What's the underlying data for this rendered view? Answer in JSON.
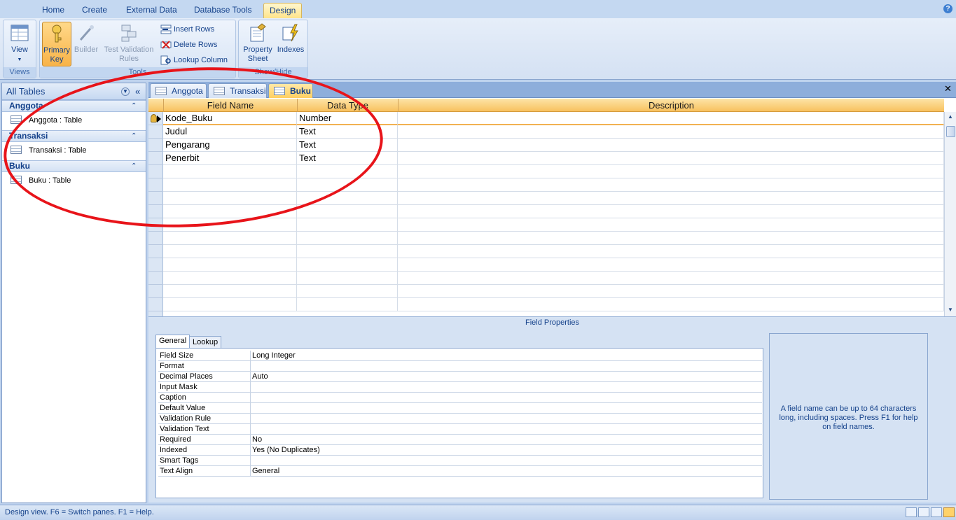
{
  "ribbon": {
    "tabs": [
      "Home",
      "Create",
      "External Data",
      "Database Tools",
      "Design"
    ],
    "active_tab": "Design",
    "groups": {
      "views": {
        "label": "Views",
        "view_button": "View"
      },
      "tools": {
        "label": "Tools",
        "primary_key": "Primary Key",
        "builder": "Builder",
        "test_validation": "Test Validation Rules",
        "insert_rows": "Insert Rows",
        "delete_rows": "Delete Rows",
        "lookup_column": "Lookup Column"
      },
      "show_hide": {
        "label": "Show/Hide",
        "property_sheet": "Property Sheet",
        "indexes": "Indexes"
      }
    }
  },
  "nav": {
    "header": "All Tables",
    "groups": [
      {
        "name": "Anggota",
        "item": "Anggota : Table"
      },
      {
        "name": "Transaksi",
        "item": "Transaksi : Table"
      },
      {
        "name": "Buku",
        "item": "Buku : Table"
      }
    ]
  },
  "doc_tabs": [
    "Anggota",
    "Transaksi",
    "Buku"
  ],
  "active_doc_tab": "Buku",
  "design_grid": {
    "columns": [
      "Field Name",
      "Data Type",
      "Description"
    ],
    "rows": [
      {
        "field": "Kode_Buku",
        "type": "Number",
        "description": "",
        "primary_key": true
      },
      {
        "field": "Judul",
        "type": "Text",
        "description": ""
      },
      {
        "field": "Pengarang",
        "type": "Text",
        "description": ""
      },
      {
        "field": "Penerbit",
        "type": "Text",
        "description": ""
      }
    ]
  },
  "field_properties": {
    "title": "Field Properties",
    "tabs": [
      "General",
      "Lookup"
    ],
    "active_tab": "General",
    "properties": [
      {
        "label": "Field Size",
        "value": "Long Integer"
      },
      {
        "label": "Format",
        "value": ""
      },
      {
        "label": "Decimal Places",
        "value": "Auto"
      },
      {
        "label": "Input Mask",
        "value": ""
      },
      {
        "label": "Caption",
        "value": ""
      },
      {
        "label": "Default Value",
        "value": ""
      },
      {
        "label": "Validation Rule",
        "value": ""
      },
      {
        "label": "Validation Text",
        "value": ""
      },
      {
        "label": "Required",
        "value": "No"
      },
      {
        "label": "Indexed",
        "value": "Yes (No Duplicates)"
      },
      {
        "label": "Smart Tags",
        "value": ""
      },
      {
        "label": "Text Align",
        "value": "General"
      }
    ],
    "help_text": "A field name can be up to 64 characters long, including spaces.  Press F1 for help on field names."
  },
  "status_bar": {
    "text": "Design view.  F6 = Switch panes.  F1 = Help."
  },
  "colors": {
    "annotation": "#e8141a",
    "accent": "#15428b",
    "active_tab": "#ffcf60"
  }
}
